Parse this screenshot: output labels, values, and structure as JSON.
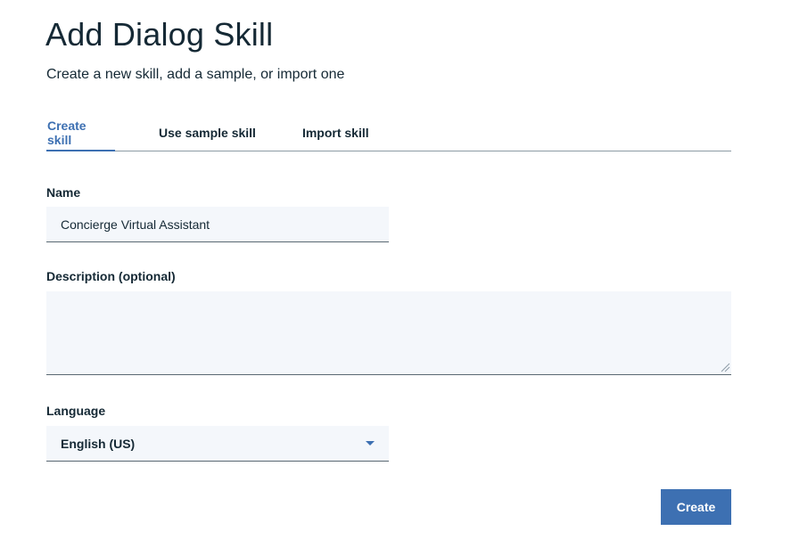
{
  "header": {
    "title": "Add Dialog Skill",
    "subtitle": "Create a new skill, add a sample, or import one"
  },
  "tabs": [
    {
      "label": "Create skill",
      "active": true
    },
    {
      "label": "Use sample skill",
      "active": false
    },
    {
      "label": "Import skill",
      "active": false
    }
  ],
  "form": {
    "name_label": "Name",
    "name_value": "Concierge Virtual Assistant",
    "description_label": "Description (optional)",
    "description_value": "",
    "language_label": "Language",
    "language_value": "English (US)"
  },
  "actions": {
    "create_label": "Create"
  },
  "colors": {
    "accent": "#3d70b2",
    "field_background": "#f4f7fb",
    "text": "#152935"
  },
  "icons": {
    "dropdown": "chevron-down-icon",
    "resize": "resize-handle-icon"
  }
}
